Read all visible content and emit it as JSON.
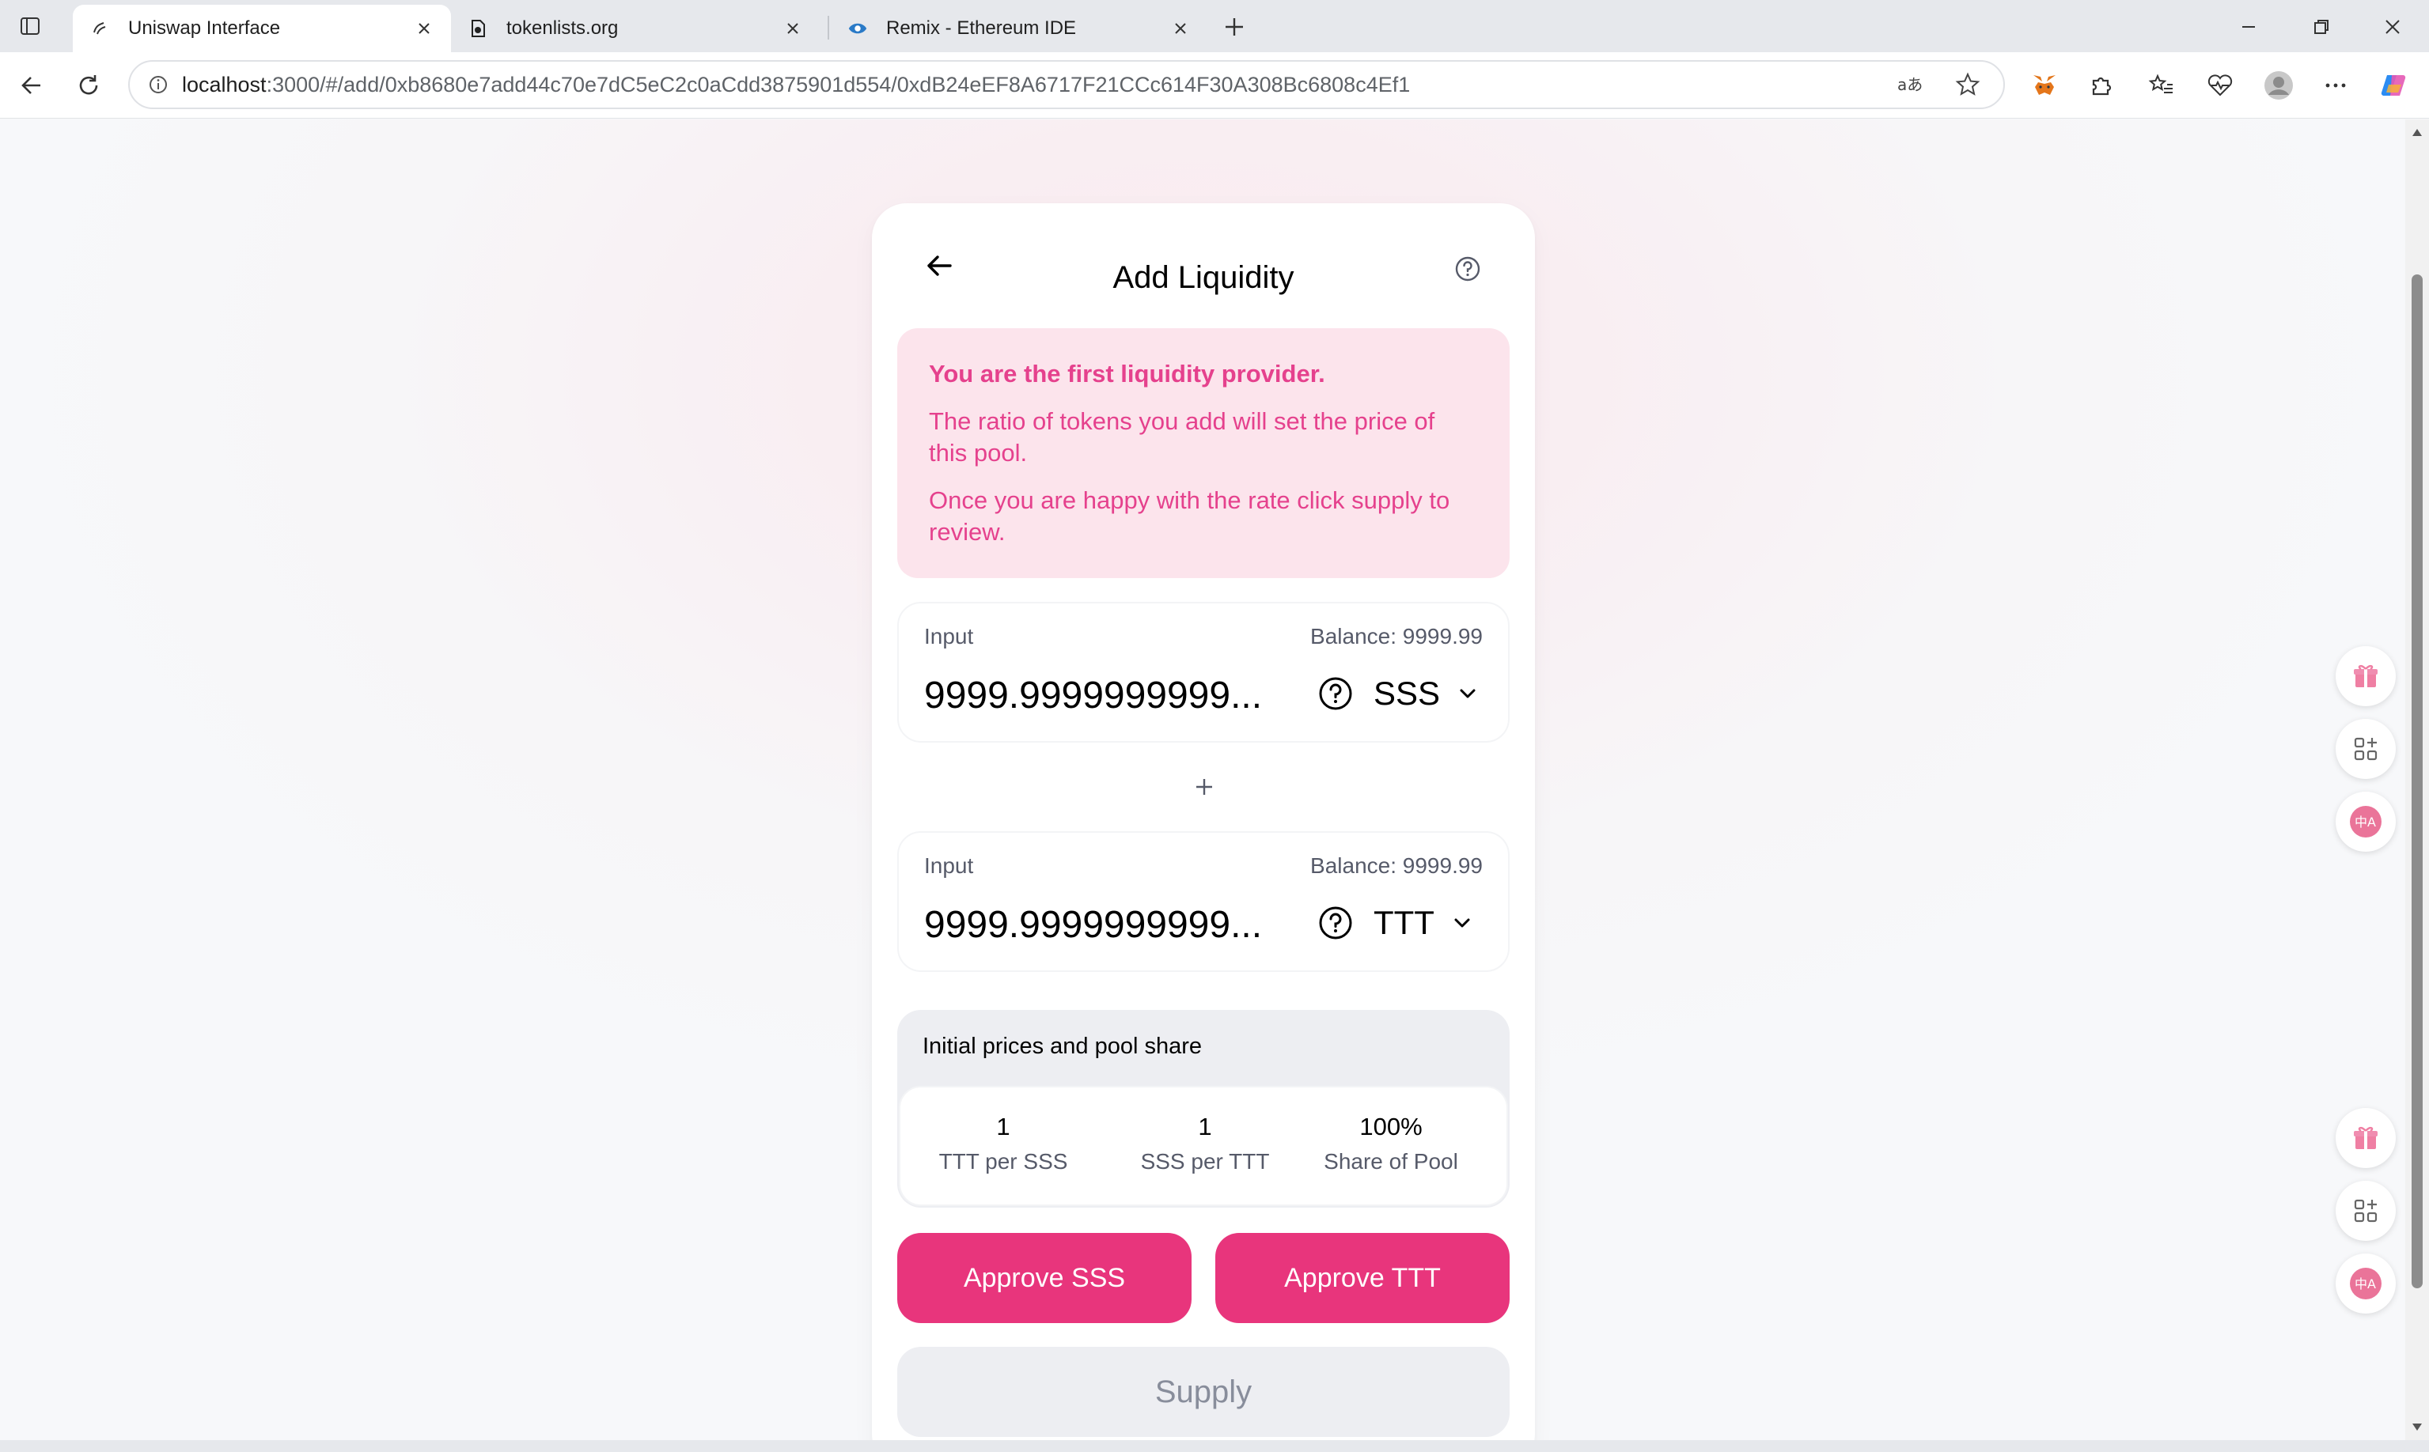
{
  "browser": {
    "tabs": [
      {
        "title": "Uniswap Interface",
        "active": true
      },
      {
        "title": "tokenlists.org",
        "active": false
      },
      {
        "title": "Remix - Ethereum IDE",
        "active": false
      }
    ],
    "address": {
      "host": "localhost",
      "path": ":3000/#/add/0xb8680e7add44c70e7dC5eC2c0aCdd3875901d554/0xdB24eEF8A6717F21CCc614F30A308Bc6808c4Ef1"
    }
  },
  "card": {
    "title": "Add Liquidity",
    "notice": {
      "heading": "You are the first liquidity provider.",
      "p1": "The ratio of tokens you add will set the price of this pool.",
      "p2": "Once you are happy with the rate click supply to review."
    },
    "input_a": {
      "label": "Input",
      "balance": "Balance: 9999.99",
      "amount": "9999.9999999999...",
      "token": "SSS"
    },
    "plus": "+",
    "input_b": {
      "label": "Input",
      "balance": "Balance: 9999.99",
      "amount": "9999.9999999999...",
      "token": "TTT"
    },
    "prices": {
      "title": "Initial prices and pool share",
      "items": [
        {
          "value": "1",
          "label": "TTT per SSS"
        },
        {
          "value": "1",
          "label": "SSS per TTT"
        },
        {
          "value": "100%",
          "label": "Share of Pool"
        }
      ]
    },
    "buttons": {
      "approve_a": "Approve SSS",
      "approve_b": "Approve TTT",
      "supply": "Supply"
    }
  },
  "colors": {
    "accent": "#e8357c",
    "notice_bg": "#fce4ec",
    "notice_text": "#e5418d"
  }
}
